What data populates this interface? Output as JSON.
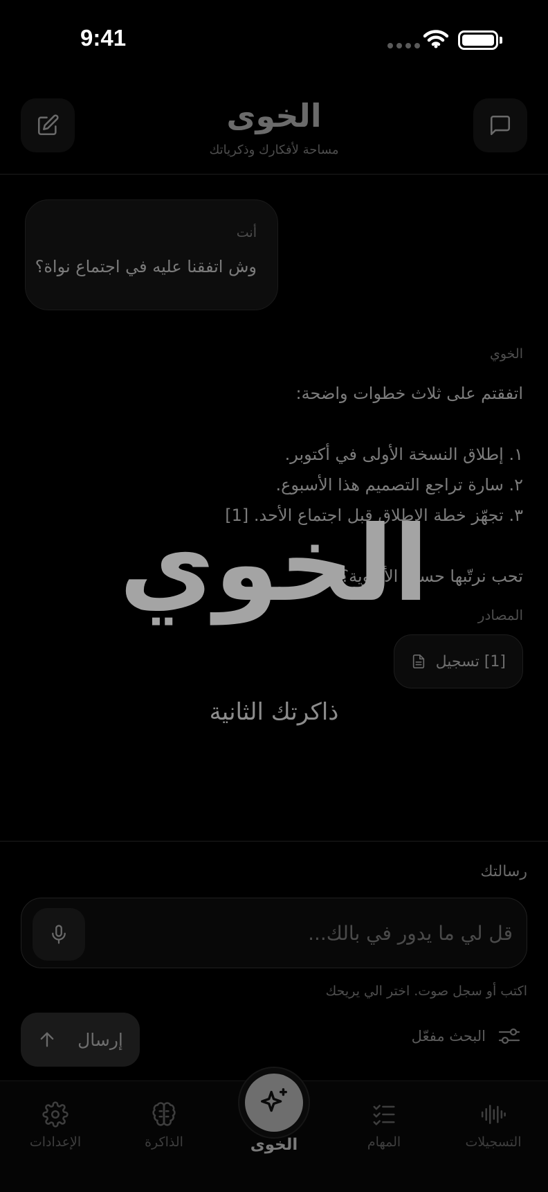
{
  "status_bar": {
    "time": "9:41"
  },
  "header": {
    "title": "الخوى",
    "subtitle": "مساحة لأفكارك وذكرياتك",
    "left_icon": "compose-icon",
    "right_icon": "chat-icon"
  },
  "conversation": {
    "user": {
      "label": "أنت",
      "text": "وش اتفقنا عليه في اجتماع نواة؟"
    },
    "assistant": {
      "label": "الخوي",
      "intro": "اتفقتم على ثلاث خطوات واضحة:",
      "steps": [
        "١. إطلاق النسخة الأولى في أكتوبر.",
        "٢. سارة تراجع التصميم هذا الأسبوع.",
        "٣. تجهّز خطة الإطلاق قبل اجتماع الأحد. [1]"
      ],
      "question": "تحب نرتّبها حسب الأولوية؟",
      "sources_label": "المصادر",
      "sources": [
        {
          "label": "[1] تسجيل",
          "icon": "document-icon"
        }
      ]
    }
  },
  "overlay": {
    "brand": "الخوي",
    "tagline": "ذاكرتك الثانية"
  },
  "composer": {
    "label": "رسالتك",
    "placeholder": "قل لي ما يدور في بالك...",
    "value": "",
    "hint": "اكتب أو سجل صوت. اختر الي يريحك",
    "send_label": "إرسال",
    "search_label": "البحث مفعّل"
  },
  "tabs": [
    {
      "label": "الإعدادات",
      "icon": "gear-icon"
    },
    {
      "label": "الذاكرة",
      "icon": "brain-icon"
    },
    {
      "label": "الخوى",
      "icon": "sparkle-icon",
      "active": true
    },
    {
      "label": "المهام",
      "icon": "checklist-icon"
    },
    {
      "label": "التسجيلات",
      "icon": "waveform-icon"
    }
  ]
}
